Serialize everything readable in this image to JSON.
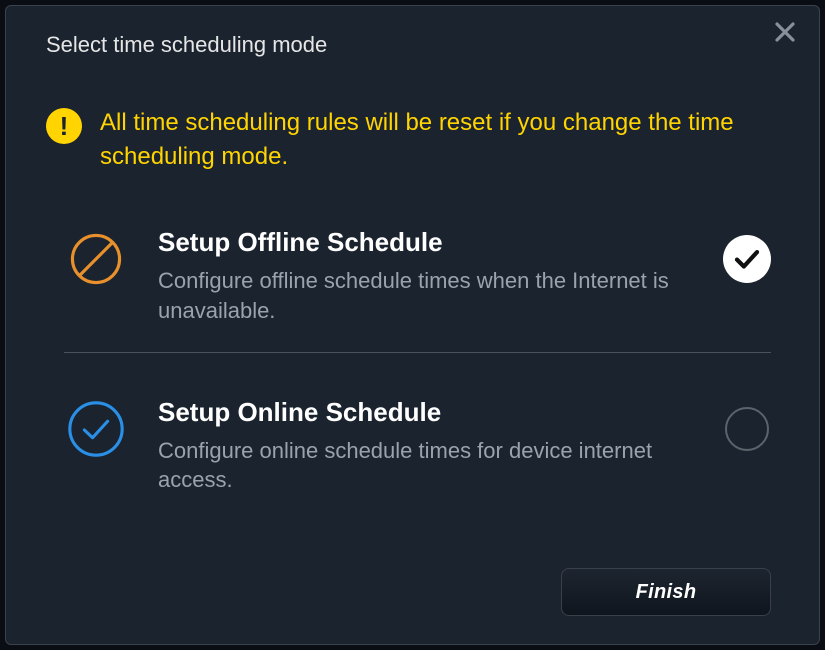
{
  "dialog": {
    "title": "Select time scheduling mode",
    "warning": "All time scheduling rules will be reset if you change the time scheduling mode.",
    "options": [
      {
        "title": "Setup Offline Schedule",
        "desc": "Configure offline schedule times when the Internet is unavailable.",
        "selected": true,
        "icon": "prohibit-icon"
      },
      {
        "title": "Setup Online Schedule",
        "desc": "Configure online schedule times for device internet access.",
        "selected": false,
        "icon": "check-circle-icon"
      }
    ],
    "finish_label": "Finish"
  },
  "colors": {
    "accent_warning": "#ffd400",
    "icon_orange": "#e8902c",
    "icon_blue": "#2a8fe6"
  }
}
